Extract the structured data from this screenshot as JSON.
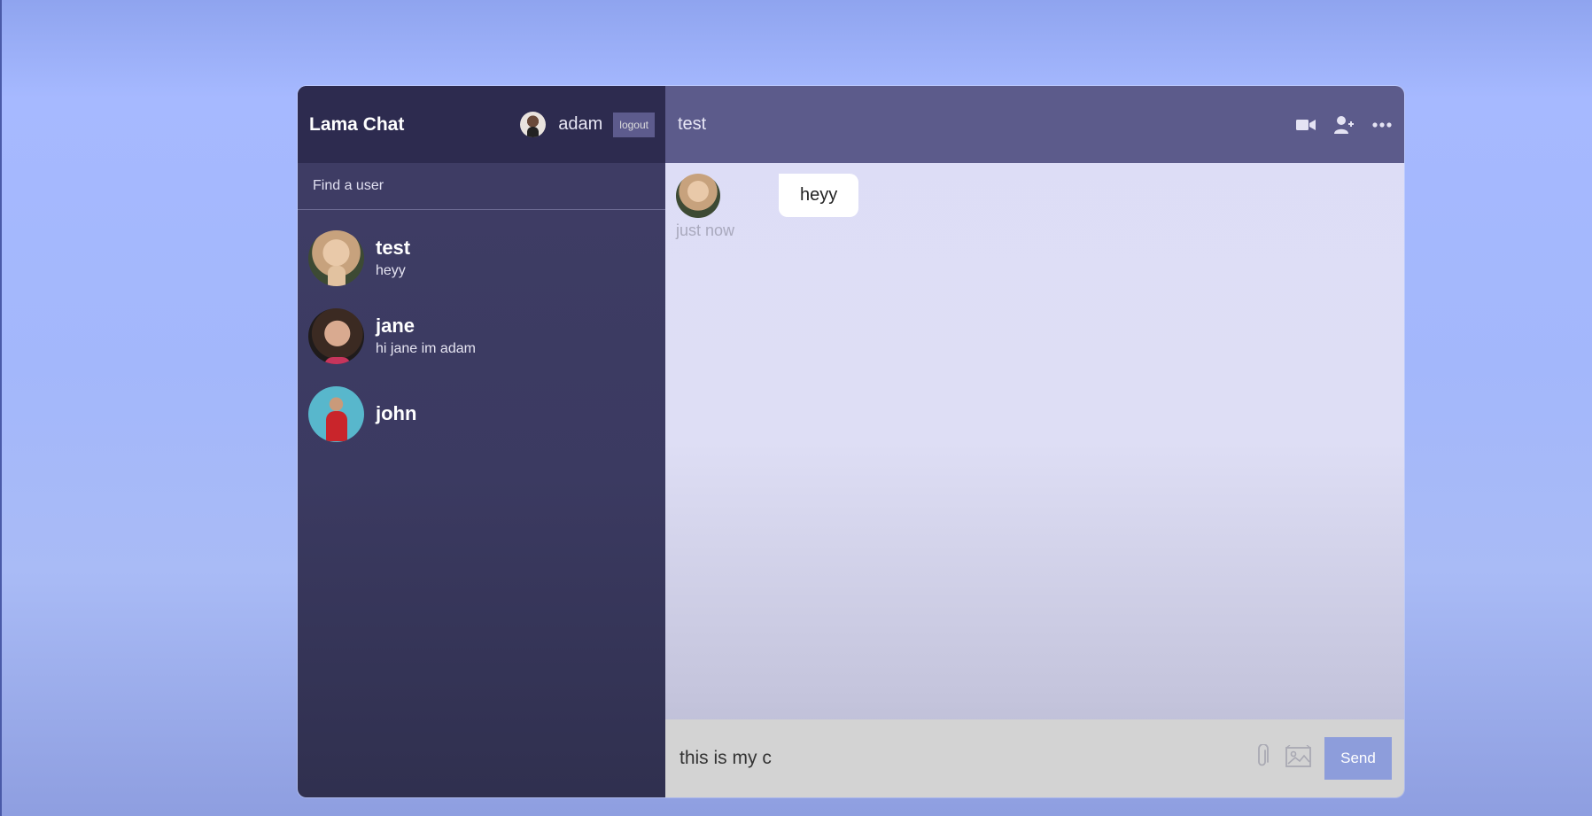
{
  "app": {
    "title": "Lama Chat",
    "current_user": {
      "name": "adam"
    },
    "logout_label": "logout"
  },
  "search": {
    "placeholder": "Find a user"
  },
  "chats": [
    {
      "name": "test",
      "last_message": "heyy"
    },
    {
      "name": "jane",
      "last_message": "hi jane im adam"
    },
    {
      "name": "john",
      "last_message": ""
    }
  ],
  "conversation": {
    "title": "test",
    "header_icons": [
      "video-camera-icon",
      "add-user-icon",
      "more-options-icon"
    ],
    "messages": [
      {
        "text": "heyy",
        "time": "just now"
      }
    ]
  },
  "composer": {
    "value": "this is my c",
    "icons": [
      "paperclip-icon",
      "image-icon"
    ],
    "send_label": "Send"
  },
  "colors": {
    "sidebar": "#3b3a61",
    "navbar": "#2d2b4f",
    "chat_header": "#5c5b8b",
    "chat_bg": "#ddddf6",
    "send_button": "#8d9ddb"
  }
}
